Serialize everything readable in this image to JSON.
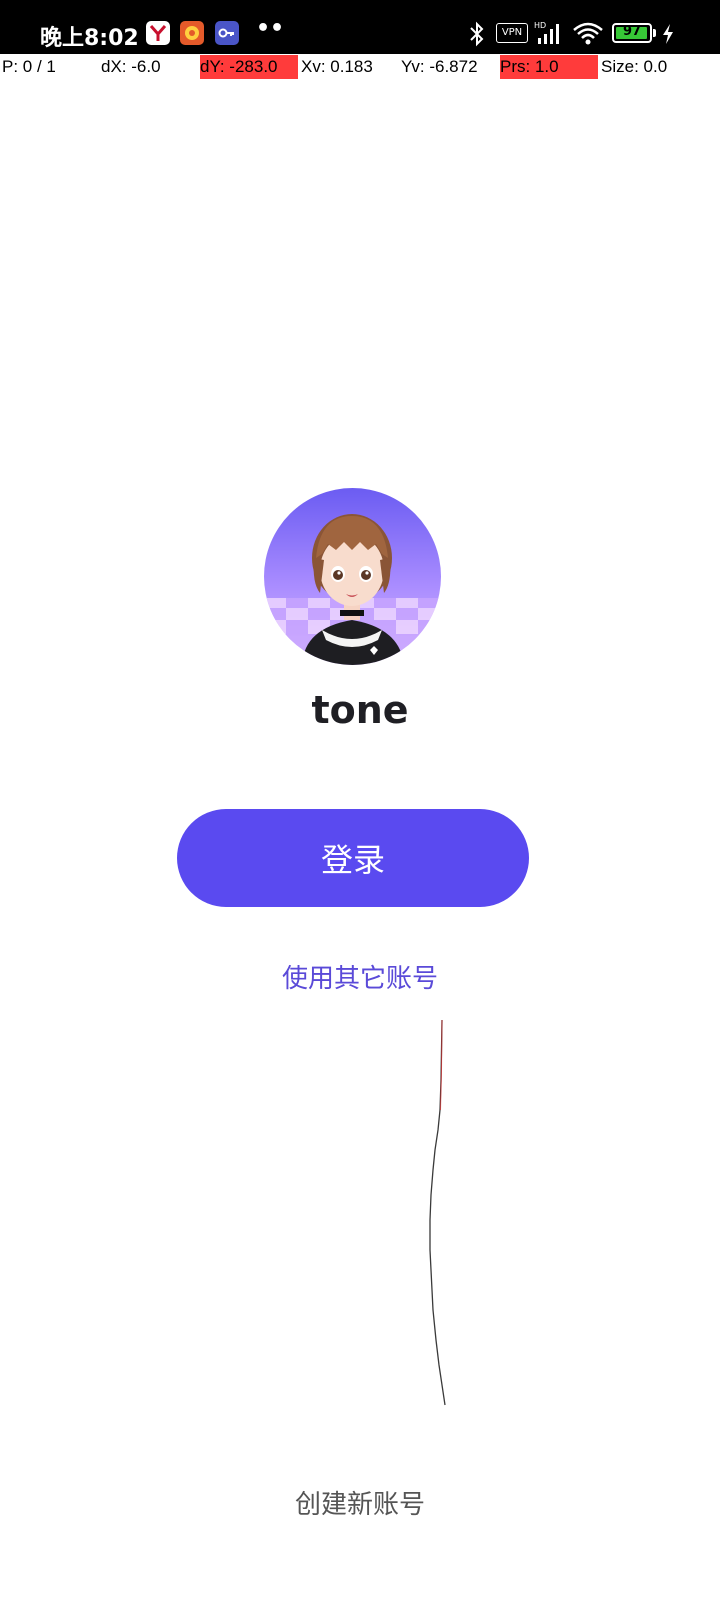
{
  "status_bar": {
    "time": "晚上8:02",
    "more_indicator": "••",
    "vpn_label": "VPN",
    "battery_level": "97"
  },
  "pointer_overlay": {
    "pointers": "P: 0 / 1",
    "dx": "dX: -6.0",
    "dy": "dY: -283.0",
    "xv": "Xv: 0.183",
    "yv": "Yv: -6.872",
    "prs": "Prs: 1.0",
    "size": "Size: 0.0",
    "highlight_color": "#ff3b3b"
  },
  "account": {
    "username": "tone",
    "avatar_icon": "avatar-3d-girl"
  },
  "actions": {
    "login_label": "登录",
    "other_account_label": "使用其它账号",
    "create_account_label": "创建新账号"
  },
  "colors": {
    "primary": "#5a4af0",
    "link": "#5a4ad8",
    "secondary_text": "#555555"
  }
}
